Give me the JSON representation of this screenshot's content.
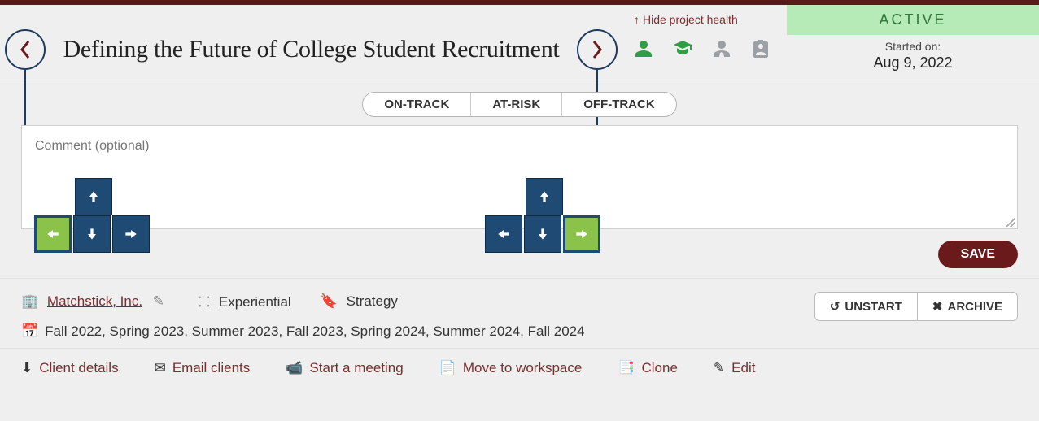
{
  "title": "Defining the Future of College Student Recruitment",
  "hide_health": "Hide project health",
  "status": {
    "label": "ACTIVE",
    "started_label": "Started on:",
    "started_date": "Aug 9, 2022"
  },
  "segmented": {
    "on": "ON-TRACK",
    "at": "AT-RISK",
    "off": "OFF-TRACK"
  },
  "comment": {
    "placeholder": "Comment (optional)"
  },
  "save_label": "SAVE",
  "meta": {
    "org": "Matchstick, Inc.",
    "category": "Experiential",
    "tag": "Strategy",
    "terms": "Fall 2022, Spring 2023, Summer 2023, Fall 2023, Spring 2024, Summer 2024, Fall 2024"
  },
  "buttons": {
    "unstart": "UNSTART",
    "archive": "ARCHIVE"
  },
  "actions": {
    "details": "Client details",
    "email": "Email clients",
    "meeting": "Start a meeting",
    "move": "Move to workspace",
    "clone": "Clone",
    "edit": "Edit"
  }
}
